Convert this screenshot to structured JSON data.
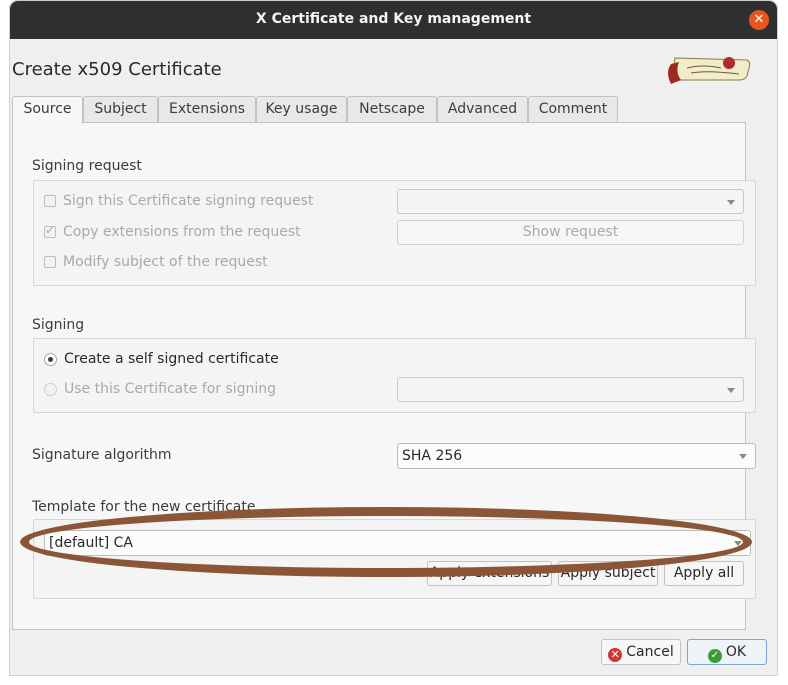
{
  "window": {
    "title": "X Certificate and Key management"
  },
  "dialog": {
    "heading": "Create x509 Certificate"
  },
  "tabs": [
    "Source",
    "Subject",
    "Extensions",
    "Key usage",
    "Netscape",
    "Advanced",
    "Comment"
  ],
  "signing_request": {
    "label": "Signing request",
    "sign_csr": "Sign this Certificate signing request",
    "copy_ext": "Copy extensions from the request",
    "modify_subject": "Modify subject of the request",
    "show_request": "Show request"
  },
  "signing": {
    "label": "Signing",
    "self_signed": "Create a self signed certificate",
    "use_cert": "Use this Certificate for signing"
  },
  "signature": {
    "label": "Signature algorithm",
    "value": "SHA 256"
  },
  "template": {
    "label": "Template for the new certificate",
    "value": "[default] CA",
    "apply_extensions": "Apply extensions",
    "apply_subject": "Apply subject",
    "apply_all": "Apply all"
  },
  "footer": {
    "cancel": "Cancel",
    "ok": "OK"
  },
  "icons": {
    "close": "close-icon",
    "cancel": "cancel-icon",
    "ok": "ok-icon",
    "logo": "xca-logo"
  },
  "colors": {
    "titlebar": "#2f2f2f",
    "close": "#e95420",
    "annotation": "#8b5637"
  }
}
